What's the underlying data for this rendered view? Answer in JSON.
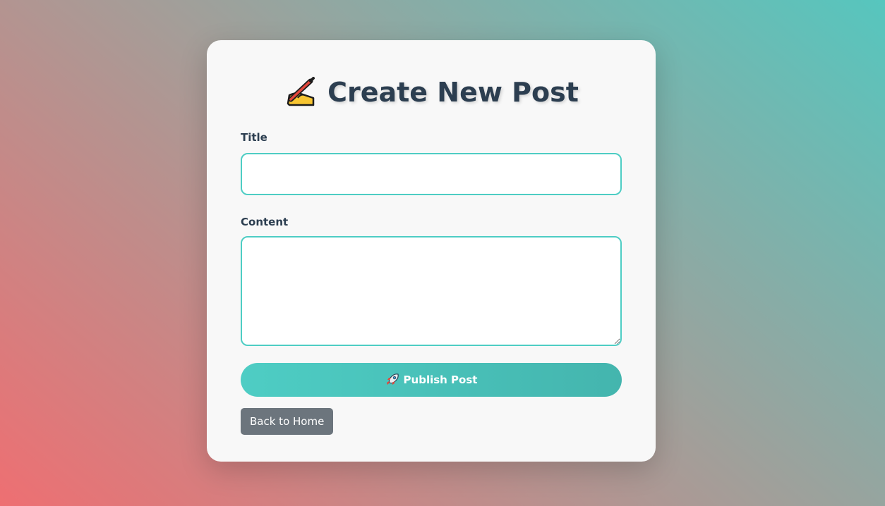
{
  "page": {
    "heading": "Create New Post",
    "heading_icon": "writing-hand-icon",
    "colors": {
      "accent": "#4ecdc4",
      "heading_text": "#2c3e50",
      "secondary_button": "#6c757d",
      "card_background": "#f8f8f8"
    }
  },
  "form": {
    "title_label": "Title",
    "title_value": "",
    "title_placeholder": "",
    "content_label": "Content",
    "content_value": "",
    "content_placeholder": "",
    "publish_label": "Publish Post",
    "publish_icon": "rocket-icon",
    "back_label": "Back to Home"
  }
}
